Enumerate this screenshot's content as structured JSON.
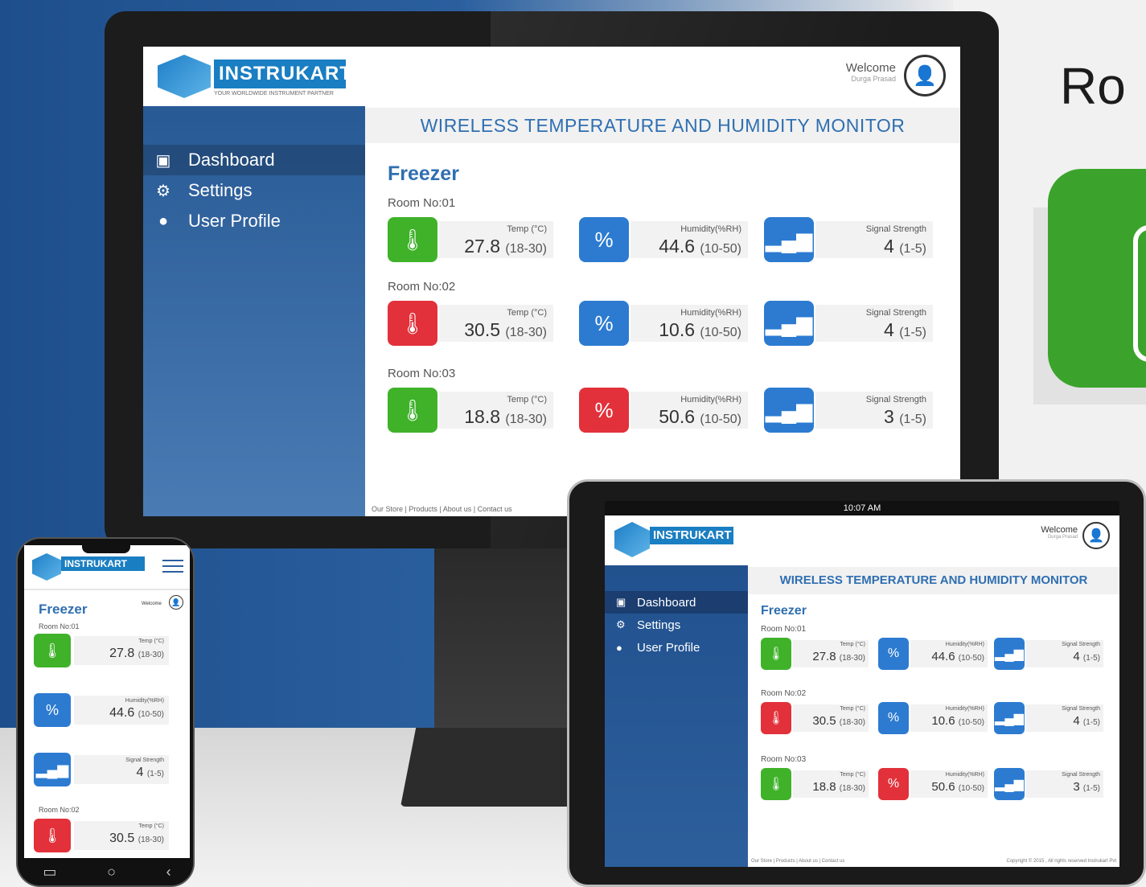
{
  "promo": {
    "title": "Ro"
  },
  "app": {
    "brand": "INSTRUKART",
    "tagline": "YOUR WORLDWIDE INSTRUMENT PARTNER",
    "welcome": "Welcome",
    "user_name": "Durga Prasad",
    "banner": "WIRELESS TEMPERATURE AND HUMIDITY MONITOR",
    "section": "Freezer",
    "nav": [
      {
        "label": "Dashboard",
        "icon": "monitor-icon"
      },
      {
        "label": "Settings",
        "icon": "gear-icon"
      },
      {
        "label": "User Profile",
        "icon": "user-circle-icon"
      }
    ],
    "footer": "Our Store  |  Products  |  About us  |  Contact us",
    "tablet_footer_right": "Copyright © 2015 , All rights reserved Instrukart Pvt",
    "tablet_time": "10:07 AM",
    "metric_labels": {
      "temp": "Temp (°C)",
      "humidity": "Humidity(%RH)",
      "signal": "Signal Strength"
    },
    "rooms": [
      {
        "name": "Room No:01",
        "temp": "27.8",
        "temp_range": "(18-30)",
        "temp_status": "green",
        "humidity": "44.6",
        "humidity_range": "(10-50)",
        "humidity_status": "blue",
        "signal": "4",
        "signal_range": "(1-5)"
      },
      {
        "name": "Room No:02",
        "temp": "30.5",
        "temp_range": "(18-30)",
        "temp_status": "red",
        "humidity": "10.6",
        "humidity_range": "(10-50)",
        "humidity_status": "blue",
        "signal": "4",
        "signal_range": "(1-5)"
      },
      {
        "name": "Room No:03",
        "temp": "18.8",
        "temp_range": "(18-30)",
        "temp_status": "green",
        "humidity": "50.6",
        "humidity_range": "(10-50)",
        "humidity_status": "red",
        "signal": "3",
        "signal_range": "(1-5)"
      }
    ],
    "colors": {
      "green": "#3fb22a",
      "red": "#e2313a",
      "blue": "#2c7bd1",
      "accent": "#2f6fb1"
    }
  }
}
